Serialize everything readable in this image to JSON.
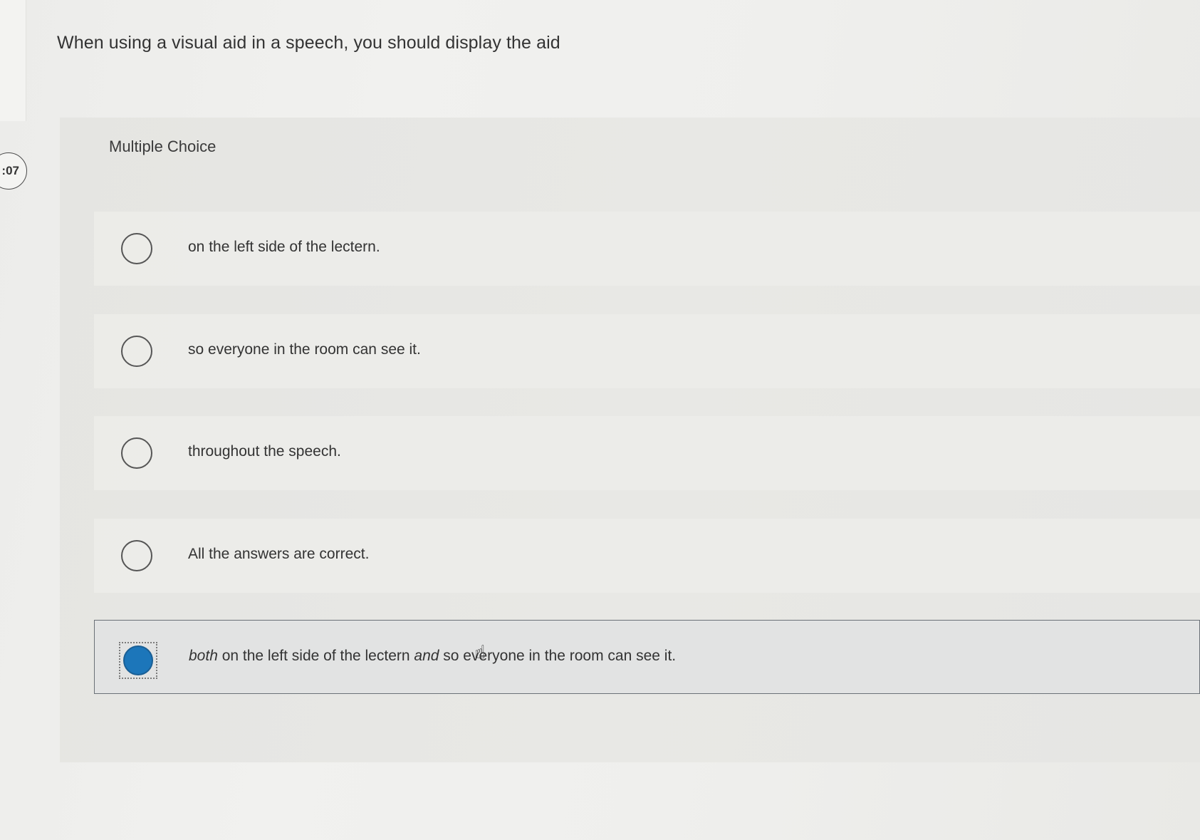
{
  "question": {
    "text": "When using a visual aid in a speech, you should display the aid"
  },
  "timer": {
    "text": ":07"
  },
  "question_type": "Multiple Choice",
  "options": [
    {
      "label": "on the left side of the lectern.",
      "selected": false
    },
    {
      "label": "so everyone in the room can see it.",
      "selected": false
    },
    {
      "label": "throughout the speech.",
      "selected": false
    },
    {
      "label": "All the answers are correct.",
      "selected": false
    },
    {
      "label_parts": {
        "part1": "both",
        "part2": " on the left side of the lectern ",
        "part3": "and",
        "part4": " so everyone in the room can see it."
      },
      "selected": true
    }
  ],
  "colors": {
    "selected_radio": "#1c76ba",
    "background": "#efefed"
  },
  "icons": {
    "cursor": "hand-pointer-icon"
  }
}
